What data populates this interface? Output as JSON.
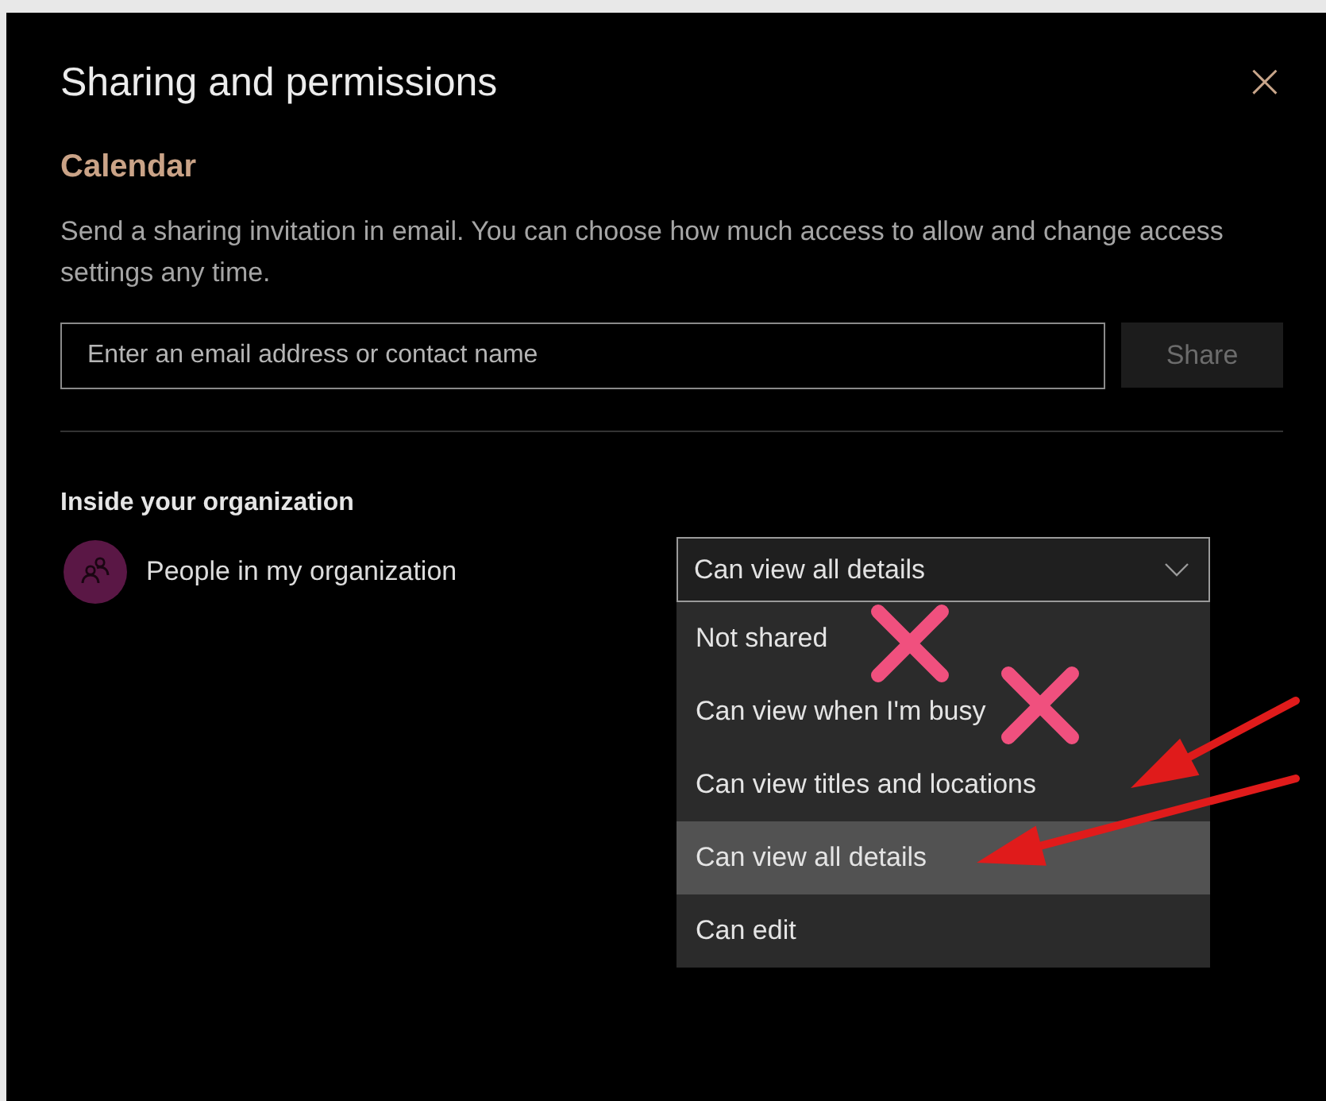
{
  "dialog": {
    "title": "Sharing and permissions",
    "close": "×"
  },
  "section": {
    "heading": "Calendar",
    "description": "Send a sharing invitation in email. You can choose how much access to allow and change access settings any time."
  },
  "invite": {
    "placeholder": "Enter an email address or contact name",
    "button": "Share",
    "button_disabled": true
  },
  "organization": {
    "heading": "Inside your organization",
    "person": "People in my organization",
    "dropdown": {
      "value": "Can view all details",
      "expanded": true,
      "options": [
        {
          "label": "Not shared",
          "selected": false
        },
        {
          "label": "Can view when I'm busy",
          "selected": false
        },
        {
          "label": "Can view titles and locations",
          "selected": false
        },
        {
          "label": "Can view all details",
          "selected": true
        },
        {
          "label": "Can edit",
          "selected": false
        }
      ]
    }
  },
  "annotations": [
    {
      "kind": "cross"
    },
    {
      "kind": "cross"
    },
    {
      "kind": "arrow"
    },
    {
      "kind": "arrow"
    }
  ]
}
